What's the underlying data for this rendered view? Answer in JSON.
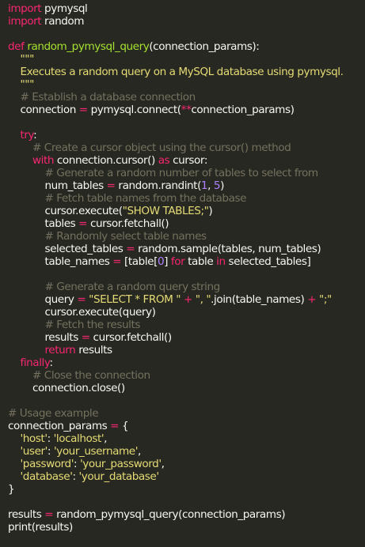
{
  "window": {
    "background": "#272822"
  },
  "theme": {
    "keyword": "#f92672",
    "function": "#a6e22e",
    "string": "#e6db74",
    "comment": "#75715e",
    "number": "#ae81ff",
    "text": "#f8f8f2"
  },
  "code": {
    "lines": [
      [
        {
          "t": "import",
          "c": "kw"
        },
        {
          "t": " pymysql",
          "c": "pl"
        }
      ],
      [
        {
          "t": "import",
          "c": "kw"
        },
        {
          "t": " random",
          "c": "pl"
        }
      ],
      [],
      [
        {
          "t": "def ",
          "c": "kw"
        },
        {
          "t": "random_pymysql_query",
          "c": "fn"
        },
        {
          "t": "(connection_params):",
          "c": "pl"
        }
      ],
      [
        {
          "t": "    \"\"\"",
          "c": "str"
        }
      ],
      [
        {
          "t": "    Executes a random query on a MySQL database using pymysql.",
          "c": "str"
        }
      ],
      [
        {
          "t": "    \"\"\"",
          "c": "str"
        }
      ],
      [
        {
          "t": "    # Establish a database connection",
          "c": "cm"
        }
      ],
      [
        {
          "t": "    connection ",
          "c": "pl"
        },
        {
          "t": "=",
          "c": "op"
        },
        {
          "t": " pymysql.connect(",
          "c": "pl"
        },
        {
          "t": "**",
          "c": "op"
        },
        {
          "t": "connection_params)",
          "c": "pl"
        }
      ],
      [],
      [
        {
          "t": "    ",
          "c": "pl"
        },
        {
          "t": "try",
          "c": "kw"
        },
        {
          "t": ":",
          "c": "pl"
        }
      ],
      [
        {
          "t": "        # Create a cursor object using the cursor() method",
          "c": "cm"
        }
      ],
      [
        {
          "t": "        ",
          "c": "pl"
        },
        {
          "t": "with",
          "c": "kw"
        },
        {
          "t": " connection.cursor() ",
          "c": "pl"
        },
        {
          "t": "as",
          "c": "kw"
        },
        {
          "t": " cursor:",
          "c": "pl"
        }
      ],
      [
        {
          "t": "            # Generate a random number of tables to select from",
          "c": "cm"
        }
      ],
      [
        {
          "t": "            num_tables ",
          "c": "pl"
        },
        {
          "t": "=",
          "c": "op"
        },
        {
          "t": " random.randint(",
          "c": "pl"
        },
        {
          "t": "1",
          "c": "num"
        },
        {
          "t": ", ",
          "c": "pl"
        },
        {
          "t": "5",
          "c": "num"
        },
        {
          "t": ")",
          "c": "pl"
        }
      ],
      [
        {
          "t": "            # Fetch table names from the database",
          "c": "cm"
        }
      ],
      [
        {
          "t": "            cursor.execute(",
          "c": "pl"
        },
        {
          "t": "\"SHOW TABLES;\"",
          "c": "str"
        },
        {
          "t": ")",
          "c": "pl"
        }
      ],
      [
        {
          "t": "            tables ",
          "c": "pl"
        },
        {
          "t": "=",
          "c": "op"
        },
        {
          "t": " cursor.fetchall()",
          "c": "pl"
        }
      ],
      [
        {
          "t": "            # Randomly select table names",
          "c": "cm"
        }
      ],
      [
        {
          "t": "            selected_tables ",
          "c": "pl"
        },
        {
          "t": "=",
          "c": "op"
        },
        {
          "t": " random.sample(tables, num_tables)",
          "c": "pl"
        }
      ],
      [
        {
          "t": "            table_names ",
          "c": "pl"
        },
        {
          "t": "=",
          "c": "op"
        },
        {
          "t": " [table[",
          "c": "pl"
        },
        {
          "t": "0",
          "c": "num"
        },
        {
          "t": "] ",
          "c": "pl"
        },
        {
          "t": "for",
          "c": "kw"
        },
        {
          "t": " table ",
          "c": "pl"
        },
        {
          "t": "in",
          "c": "kw"
        },
        {
          "t": " selected_tables]",
          "c": "pl"
        }
      ],
      [],
      [
        {
          "t": "            # Generate a random query string",
          "c": "cm"
        }
      ],
      [
        {
          "t": "            query ",
          "c": "pl"
        },
        {
          "t": "=",
          "c": "op"
        },
        {
          "t": " ",
          "c": "pl"
        },
        {
          "t": "\"SELECT * FROM \"",
          "c": "str"
        },
        {
          "t": " ",
          "c": "pl"
        },
        {
          "t": "+",
          "c": "op"
        },
        {
          "t": " ",
          "c": "pl"
        },
        {
          "t": "\", \"",
          "c": "str"
        },
        {
          "t": ".join(table_names) ",
          "c": "pl"
        },
        {
          "t": "+",
          "c": "op"
        },
        {
          "t": " ",
          "c": "pl"
        },
        {
          "t": "\";\"",
          "c": "str"
        }
      ],
      [
        {
          "t": "            cursor.execute(query)",
          "c": "pl"
        }
      ],
      [
        {
          "t": "            # Fetch the results",
          "c": "cm"
        }
      ],
      [
        {
          "t": "            results ",
          "c": "pl"
        },
        {
          "t": "=",
          "c": "op"
        },
        {
          "t": " cursor.fetchall()",
          "c": "pl"
        }
      ],
      [
        {
          "t": "            ",
          "c": "pl"
        },
        {
          "t": "return",
          "c": "kw"
        },
        {
          "t": " results",
          "c": "pl"
        }
      ],
      [
        {
          "t": "    ",
          "c": "pl"
        },
        {
          "t": "finally",
          "c": "kw"
        },
        {
          "t": ":",
          "c": "pl"
        }
      ],
      [
        {
          "t": "        # Close the connection",
          "c": "cm"
        }
      ],
      [
        {
          "t": "        connection.close()",
          "c": "pl"
        }
      ],
      [],
      [
        {
          "t": "# Usage example",
          "c": "cm"
        }
      ],
      [
        {
          "t": "connection_params ",
          "c": "pl"
        },
        {
          "t": "=",
          "c": "op"
        },
        {
          "t": " {",
          "c": "pl"
        }
      ],
      [
        {
          "t": "    ",
          "c": "pl"
        },
        {
          "t": "'host'",
          "c": "str"
        },
        {
          "t": ": ",
          "c": "pl"
        },
        {
          "t": "'localhost'",
          "c": "str"
        },
        {
          "t": ",",
          "c": "pl"
        }
      ],
      [
        {
          "t": "    ",
          "c": "pl"
        },
        {
          "t": "'user'",
          "c": "str"
        },
        {
          "t": ": ",
          "c": "pl"
        },
        {
          "t": "'your_username'",
          "c": "str"
        },
        {
          "t": ",",
          "c": "pl"
        }
      ],
      [
        {
          "t": "    ",
          "c": "pl"
        },
        {
          "t": "'password'",
          "c": "str"
        },
        {
          "t": ": ",
          "c": "pl"
        },
        {
          "t": "'your_password'",
          "c": "str"
        },
        {
          "t": ",",
          "c": "pl"
        }
      ],
      [
        {
          "t": "    ",
          "c": "pl"
        },
        {
          "t": "'database'",
          "c": "str"
        },
        {
          "t": ": ",
          "c": "pl"
        },
        {
          "t": "'your_database'",
          "c": "str"
        }
      ],
      [
        {
          "t": "}",
          "c": "pl"
        }
      ],
      [],
      [
        {
          "t": "results ",
          "c": "pl"
        },
        {
          "t": "=",
          "c": "op"
        },
        {
          "t": " random_pymysql_query(connection_params)",
          "c": "pl"
        }
      ],
      [
        {
          "t": "print",
          "c": "pl"
        },
        {
          "t": "(results)",
          "c": "pl"
        }
      ]
    ]
  }
}
